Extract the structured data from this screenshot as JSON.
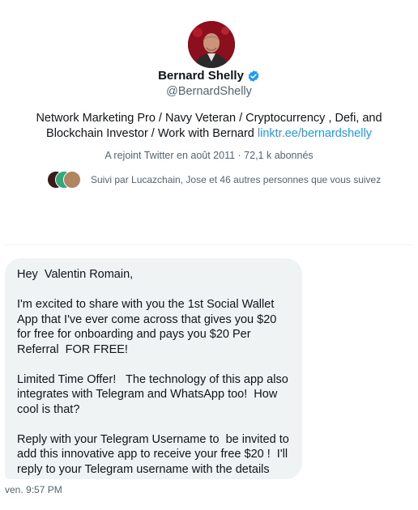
{
  "profile": {
    "name": "Bernard Shelly",
    "handle": "@BernardShelly",
    "bio_text": "Network Marketing Pro / Navy Veteran / Cryptocurrency , Defi, and Blockchain Investor / Work with Bernard ",
    "bio_link": "linktr.ee/bernardshelly",
    "meta": "A rejoint Twitter en août 2011 · 72,1 k abonnés",
    "followed_by": "Suivi par Lucazchain, Jose et 46 autres personnes que vous suivez"
  },
  "message": {
    "paragraphs": [
      "Hey  Valentin Romain,",
      "I'm excited to share with you the 1st Social Wallet App that I've ever come across that gives you $20 for free for onboarding and pays you $20 Per Referral  FOR FREE!",
      "Limited Time Offer!   The technology of this app also integrates with Telegram and WhatsApp too!  How cool is that?",
      "Reply with your Telegram Username to  be invited to add this innovative app to receive your free $20 !  I'll reply to your Telegram username with the details"
    ],
    "timestamp": "ven. 9:57 PM"
  },
  "colors": {
    "accent": "#1d9bf0",
    "bubble_bg": "#eff3f4",
    "secondary_text": "#536471"
  },
  "icons": [
    "verified-badge-icon"
  ]
}
